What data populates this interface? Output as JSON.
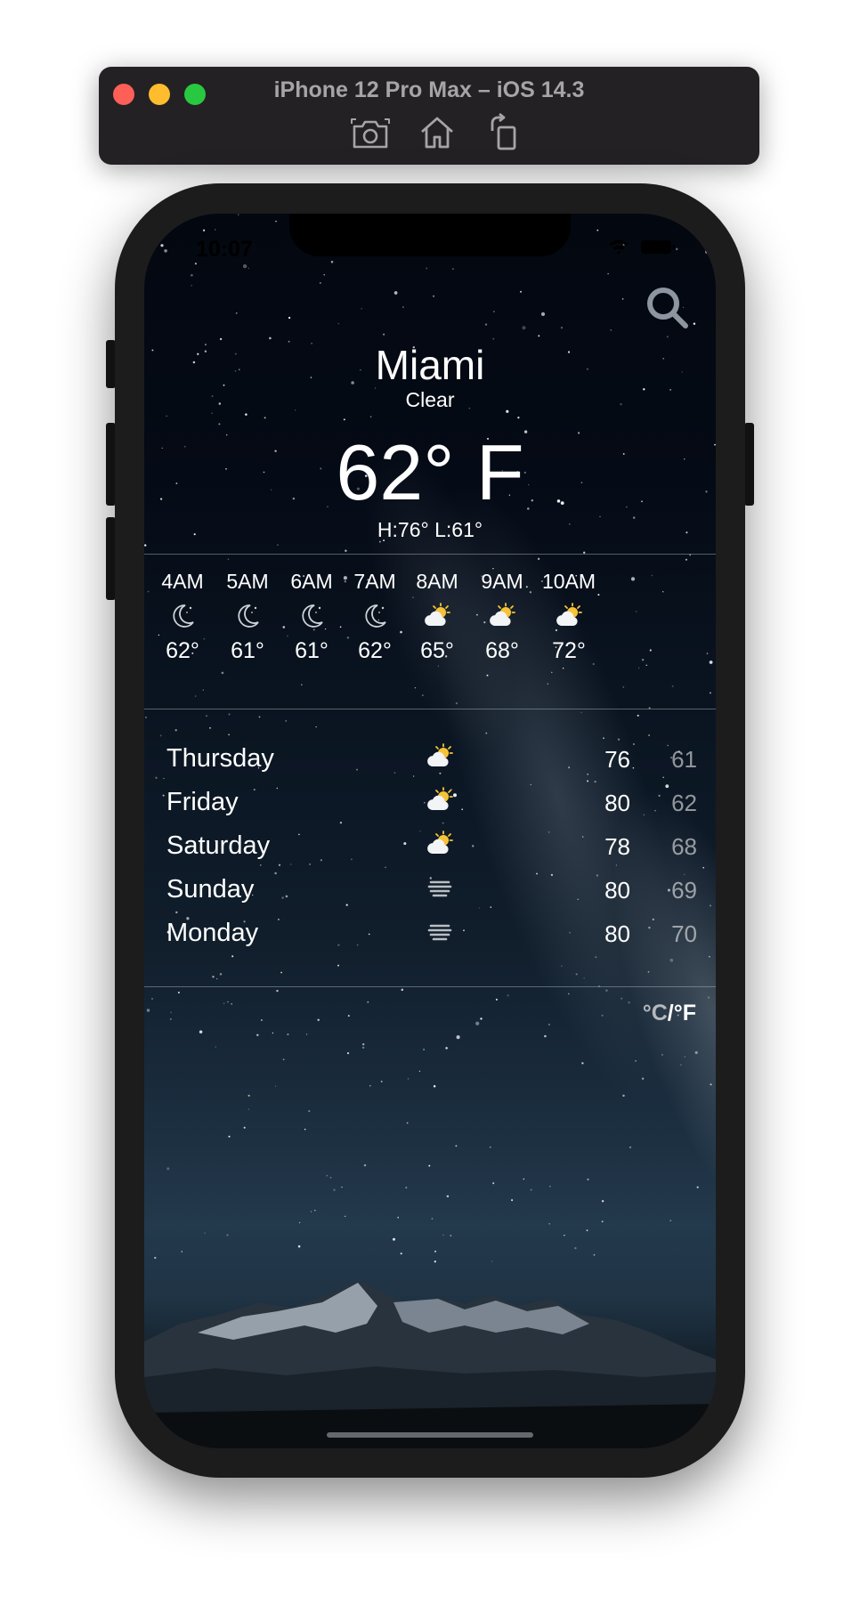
{
  "simulator": {
    "title": "iPhone 12 Pro Max – iOS 14.3",
    "tools": [
      "screenshot-icon",
      "home-icon",
      "rotate-icon"
    ]
  },
  "status_bar": {
    "time": "10:07"
  },
  "current": {
    "city": "Miami",
    "condition": "Clear",
    "temperature": "62° F",
    "high_low": "H:76° L:61°"
  },
  "hourly": [
    {
      "time": "4AM",
      "icon": "moon-icon",
      "temp": "62°"
    },
    {
      "time": "5AM",
      "icon": "moon-icon",
      "temp": "61°"
    },
    {
      "time": "6AM",
      "icon": "moon-icon",
      "temp": "61°"
    },
    {
      "time": "7AM",
      "icon": "moon-icon",
      "temp": "62°"
    },
    {
      "time": "8AM",
      "icon": "partly-cloudy-icon",
      "temp": "65°"
    },
    {
      "time": "9AM",
      "icon": "partly-cloudy-icon",
      "temp": "68°"
    },
    {
      "time": "10AM",
      "icon": "partly-cloudy-icon",
      "temp": "72°"
    }
  ],
  "daily": [
    {
      "day": "Thursday",
      "icon": "partly-cloudy-icon",
      "high": "76",
      "low": "61"
    },
    {
      "day": "Friday",
      "icon": "partly-cloudy-icon",
      "high": "80",
      "low": "62"
    },
    {
      "day": "Saturday",
      "icon": "partly-cloudy-icon",
      "high": "78",
      "low": "68"
    },
    {
      "day": "Sunday",
      "icon": "fog-icon",
      "high": "80",
      "low": "69"
    },
    {
      "day": "Monday",
      "icon": "fog-icon",
      "high": "80",
      "low": "70"
    }
  ],
  "unit_toggle": {
    "celsius": "°C",
    "separator": "/",
    "fahrenheit": "°F"
  },
  "colors": {
    "text": "#ffffff",
    "sun": "#f6c338",
    "traffic_red": "#fe5f57",
    "traffic_yellow": "#febc2e",
    "traffic_green": "#28c840"
  }
}
